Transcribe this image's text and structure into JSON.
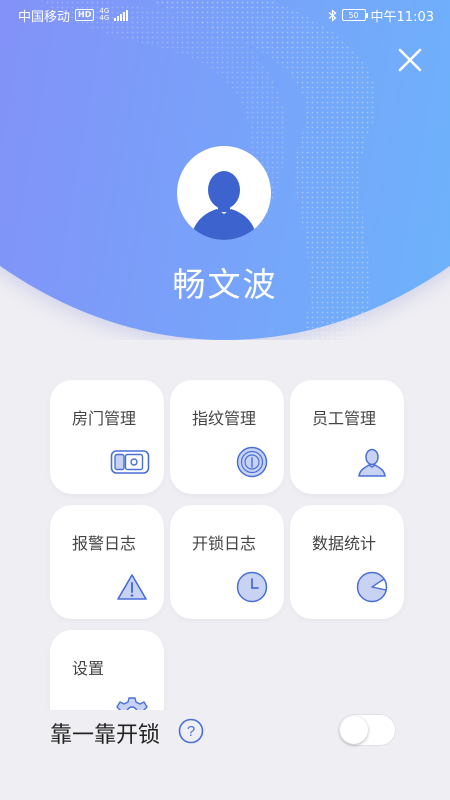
{
  "statusbar": {
    "carrier": "中国移动",
    "hd": "HD",
    "net_top": "4G",
    "net_bottom": "4G",
    "battery": "50",
    "time": "中午11:03"
  },
  "profile": {
    "name": "畅文波"
  },
  "menu": [
    {
      "label": "房门管理",
      "icon": "door-lock-icon"
    },
    {
      "label": "指纹管理",
      "icon": "fingerprint-icon"
    },
    {
      "label": "员工管理",
      "icon": "person-icon"
    },
    {
      "label": "报警日志",
      "icon": "warning-icon"
    },
    {
      "label": "开锁日志",
      "icon": "clock-icon"
    },
    {
      "label": "数据统计",
      "icon": "pie-chart-icon"
    },
    {
      "label": "设置",
      "icon": "gear-icon"
    }
  ],
  "bump_unlock": {
    "label": "靠一靠开锁",
    "help_symbol": "?",
    "enabled": false
  },
  "colors": {
    "accent": "#4a6fd6",
    "header_start": "#7a7df6",
    "header_end": "#67c3fd"
  }
}
